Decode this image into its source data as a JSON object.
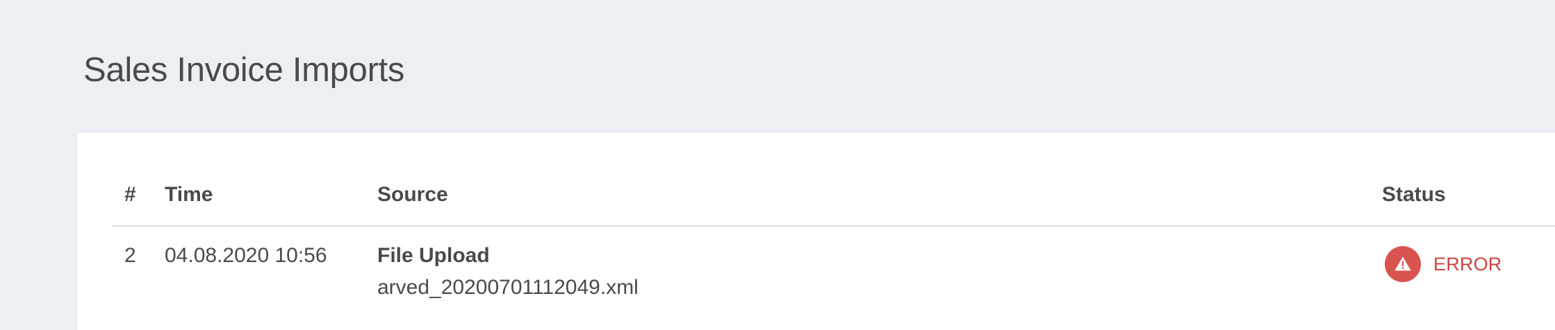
{
  "page": {
    "title": "Sales Invoice Imports"
  },
  "table": {
    "headers": {
      "number": "#",
      "time": "Time",
      "source": "Source",
      "status": "Status"
    },
    "rows": [
      {
        "number": "2",
        "time": "04.08.2020 10:56",
        "source_type": "File Upload",
        "source_file": "arved_20200701112049.xml",
        "status": "ERROR",
        "status_icon": "warning-icon"
      }
    ]
  },
  "colors": {
    "background": "#eceff4",
    "card": "#ffffff",
    "error": "#d9534f"
  }
}
